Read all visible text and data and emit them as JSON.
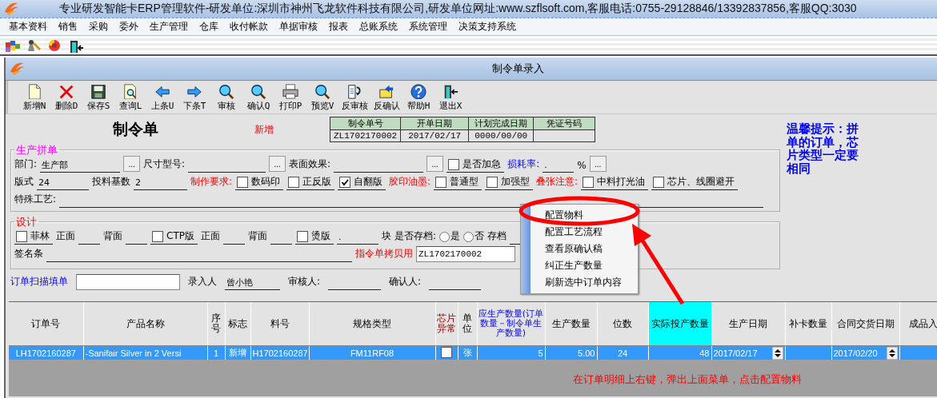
{
  "app": {
    "title": "专业研发智能卡ERP管理软件-研发单位:深圳市神州飞龙软件科技有限公司,研发单位网址:www.szflsoft.com,客服电话:0755-29128846/13392837856,客服QQ:3030"
  },
  "menu": [
    "基本资料",
    "销售",
    "采购",
    "委外",
    "生产管理",
    "仓库",
    "收付帐款",
    "单据审核",
    "报表",
    "总账系统",
    "系统管理",
    "决策支持系统"
  ],
  "window": {
    "title": "制令单录入"
  },
  "toolbar": [
    {
      "kind": "new",
      "label": "新增N"
    },
    {
      "kind": "delete",
      "label": "删除D"
    },
    {
      "kind": "save",
      "label": "保存S"
    },
    {
      "kind": "query",
      "label": "查询L"
    },
    {
      "kind": "prev",
      "label": "上条U"
    },
    {
      "kind": "next",
      "label": "下条T"
    },
    {
      "kind": "audit",
      "label": "审核"
    },
    {
      "kind": "audit",
      "label": "确认Q"
    },
    {
      "kind": "print",
      "label": "打印P"
    },
    {
      "kind": "audit",
      "label": "预览V"
    },
    {
      "kind": "unaudit",
      "label": "反审核"
    },
    {
      "kind": "unconfirm",
      "label": "反确认"
    },
    {
      "kind": "help",
      "label": "帮助H"
    },
    {
      "kind": "exit",
      "label": "退出X"
    }
  ],
  "form": {
    "heading": "制令单",
    "status": "新增",
    "info_table": {
      "columns": [
        "制令单号",
        "开单日期",
        "计划完成日期",
        "凭证号码"
      ],
      "values": [
        "ZL1702170002",
        "2017/02/17",
        "0000/00/00"
      ]
    }
  },
  "tip": "温馨提示：拼单的订单，芯片类型一定要相同",
  "production": {
    "legend": "生产拼单",
    "rows": [
      {
        "items": [
          {
            "kind": "label",
            "text": "部门:"
          },
          {
            "kind": "field",
            "value": "生产部"
          },
          {
            "kind": "button",
            "label": "..."
          },
          {
            "kind": "label",
            "text": "尺寸型号:"
          },
          {
            "kind": "field"
          },
          {
            "kind": "button",
            "label": "..."
          },
          {
            "kind": "label",
            "text": "表面效果:"
          },
          {
            "kind": "field"
          },
          {
            "kind": "button",
            "label": "..."
          },
          {
            "kind": "checkbox",
            "label": "是否加急",
            "checked": false
          },
          {
            "kind": "info_label",
            "text": "损耗率:"
          },
          {
            "kind": "field",
            "value": "."
          },
          {
            "kind": "unit",
            "text": "%"
          },
          {
            "kind": "button",
            "label": "..."
          }
        ]
      },
      {
        "items": [
          {
            "kind": "label",
            "text": "版式"
          },
          {
            "kind": "field",
            "value": "24"
          },
          {
            "kind": "label",
            "text": "投料基数"
          },
          {
            "kind": "field",
            "value": "2"
          },
          {
            "kind": "alert_label",
            "text": "制作要求:"
          },
          {
            "kind": "checkbox",
            "label": "数码印",
            "checked": false
          },
          {
            "kind": "checkbox",
            "label": "正反版",
            "checked": false
          },
          {
            "kind": "checkbox",
            "label": "自翻版",
            "checked": true
          },
          {
            "kind": "alert_label",
            "text": "胶印油墨:"
          },
          {
            "kind": "checkbox",
            "label": "普通型",
            "checked": false
          },
          {
            "kind": "checkbox",
            "label": "加强型",
            "checked": false
          },
          {
            "kind": "alert_label",
            "text": "叠张注意:"
          },
          {
            "kind": "checkbox",
            "label": "中料打光油",
            "checked": false
          },
          {
            "kind": "checkbox",
            "label": "芯片、线圈避开",
            "checked": false
          }
        ]
      },
      {
        "items": [
          {
            "kind": "label",
            "text": "特殊工艺:"
          },
          {
            "kind": "field"
          }
        ]
      }
    ]
  },
  "design": {
    "legend": "设计",
    "rows": [
      {
        "items": [
          {
            "kind": "checkbox",
            "label": "菲林",
            "checked": false
          },
          {
            "kind": "label",
            "text": "正面"
          },
          {
            "kind": "field"
          },
          {
            "kind": "label",
            "text": "背面"
          },
          {
            "kind": "field"
          },
          {
            "kind": "checkbox",
            "label": "CTP版",
            "checked": false
          },
          {
            "kind": "label",
            "text": "正面"
          },
          {
            "kind": "field"
          },
          {
            "kind": "label",
            "text": "背面"
          },
          {
            "kind": "field"
          },
          {
            "kind": "checkbox",
            "label": "烫版",
            "checked": false
          },
          {
            "kind": "field",
            "value": "."
          },
          {
            "kind": "unit",
            "text": "块"
          },
          {
            "kind": "label",
            "text": "是否存档:"
          },
          {
            "kind": "radio",
            "label": "是",
            "selected": false
          },
          {
            "kind": "radio",
            "label": "否",
            "selected": false
          },
          {
            "kind": "label",
            "text": "存档"
          },
          {
            "kind": "field"
          }
        ]
      },
      {
        "items": [
          {
            "kind": "label",
            "text": "签名条"
          },
          {
            "kind": "field"
          },
          {
            "kind": "alert_label",
            "text": "指令单拷贝用"
          },
          {
            "kind": "box",
            "value": "ZL1702170002"
          }
        ]
      }
    ]
  },
  "scan_row": [
    {
      "kind": "info_label",
      "text": "订单扫描填单"
    },
    {
      "kind": "box"
    },
    {
      "kind": "label",
      "text": "录入人"
    },
    {
      "kind": "field",
      "value": "曾小艳"
    },
    {
      "kind": "label",
      "text": "审核人:"
    },
    {
      "kind": "field"
    },
    {
      "kind": "label",
      "text": "确认人:"
    },
    {
      "kind": "field"
    }
  ],
  "grid": {
    "columns": [
      {
        "label": "订单号",
        "kind": "plain"
      },
      {
        "label": "产品名称",
        "kind": "plain"
      },
      {
        "label": "序号",
        "kind": "plain"
      },
      {
        "label": "标志",
        "kind": "plain"
      },
      {
        "label": "料号",
        "kind": "plain"
      },
      {
        "label": "规格类型",
        "kind": "plain"
      },
      {
        "label": "芯片异常",
        "kind": "alert"
      },
      {
        "label": "单位",
        "kind": "plain"
      },
      {
        "label": "应生产数量(订单数量－制令单生产数量)",
        "kind": "computed"
      },
      {
        "label": "生产数量",
        "kind": "plain"
      },
      {
        "label": "位数",
        "kind": "plain"
      },
      {
        "label": "实际投产数量",
        "kind": "highlight"
      },
      {
        "label": "生产日期",
        "kind": "plain"
      },
      {
        "label": "补卡数量",
        "kind": "plain"
      },
      {
        "label": "合同交货日期",
        "kind": "plain"
      },
      {
        "label": "成品入",
        "kind": "plain"
      }
    ],
    "rows": [
      {
        "selected": true,
        "cells": [
          {
            "kind": "text",
            "text": "LH1702160287"
          },
          {
            "kind": "text",
            "text": "-Sanifair Silver in 2 Versi"
          },
          {
            "kind": "text",
            "text": "1"
          },
          {
            "kind": "text",
            "text": "新增"
          },
          {
            "kind": "text",
            "text": "H1702160287"
          },
          {
            "kind": "text",
            "text": "FM11RF08"
          },
          {
            "kind": "checkbox",
            "checked": false
          },
          {
            "kind": "text",
            "text": "张"
          },
          {
            "kind": "text",
            "text": "5"
          },
          {
            "kind": "text",
            "text": "5.00"
          },
          {
            "kind": "text",
            "text": "24"
          },
          {
            "kind": "text",
            "text": "48"
          },
          {
            "kind": "date",
            "text": "2017/02/17"
          },
          {
            "kind": "empty"
          },
          {
            "kind": "date",
            "text": "2017/02/20"
          },
          {
            "kind": "empty"
          }
        ]
      }
    ]
  },
  "context_menu": [
    "配置物料",
    "配置工艺流程",
    "查看原确认稿",
    "纠正生产数量",
    "刷新选中订单内容"
  ],
  "annotation": "在订单明细上右键，弹出上面菜单，点击配置物料"
}
